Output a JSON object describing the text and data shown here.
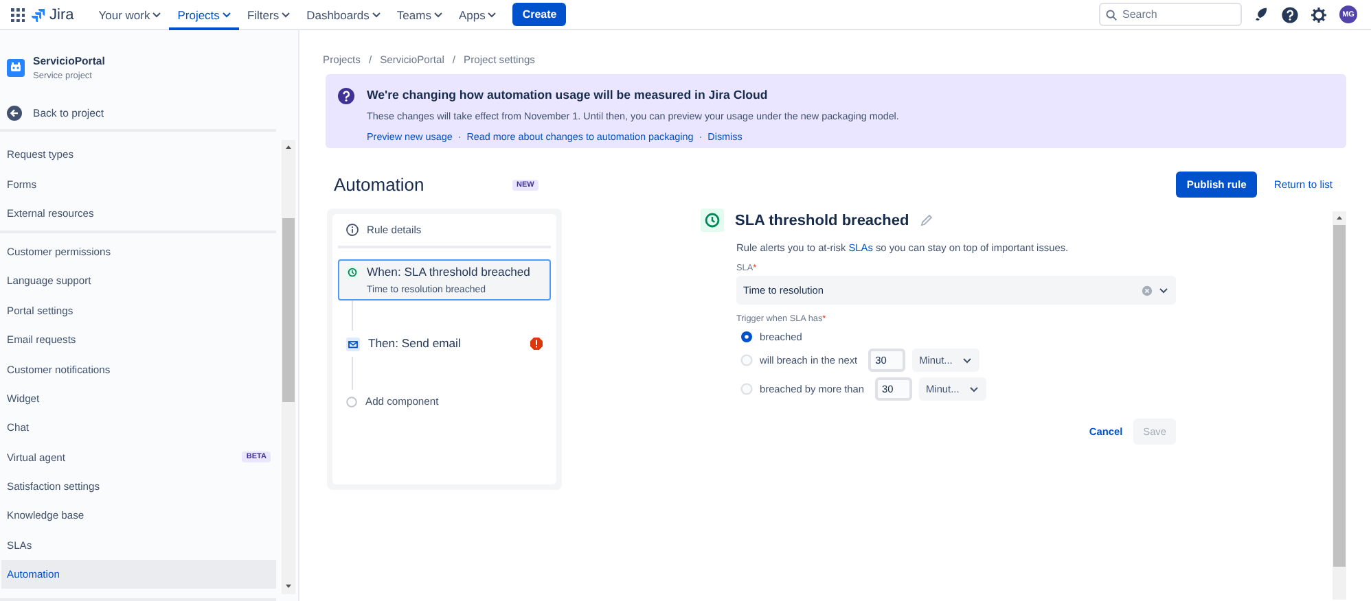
{
  "topnav": {
    "product": "Jira",
    "menus": [
      {
        "label": "Your work",
        "selected": false
      },
      {
        "label": "Projects",
        "selected": true
      },
      {
        "label": "Filters",
        "selected": false
      },
      {
        "label": "Dashboards",
        "selected": false
      },
      {
        "label": "Teams",
        "selected": false
      },
      {
        "label": "Apps",
        "selected": false
      }
    ],
    "create": "Create",
    "search": {
      "placeholder": "Search"
    },
    "avatar": "MG"
  },
  "sidebar": {
    "project": {
      "name": "ServicioPortal",
      "type": "Service project"
    },
    "back": "Back to project",
    "sections": [
      {
        "items": [
          {
            "label": "Request types",
            "selected": false
          },
          {
            "label": "Forms",
            "selected": false
          },
          {
            "label": "External resources",
            "selected": false
          }
        ]
      },
      {
        "items": [
          {
            "label": "Customer permissions",
            "selected": false
          },
          {
            "label": "Language support",
            "selected": false
          },
          {
            "label": "Portal settings",
            "selected": false
          },
          {
            "label": "Email requests",
            "selected": false
          },
          {
            "label": "Customer notifications",
            "selected": false
          },
          {
            "label": "Widget",
            "selected": false
          },
          {
            "label": "Chat",
            "selected": false
          },
          {
            "label": "Virtual agent",
            "selected": false,
            "badge": "BETA"
          },
          {
            "label": "Satisfaction settings",
            "selected": false
          },
          {
            "label": "Knowledge base",
            "selected": false
          },
          {
            "label": "SLAs",
            "selected": false
          },
          {
            "label": "Automation",
            "selected": true
          }
        ]
      }
    ]
  },
  "breadcrumbs": {
    "items": [
      "Projects",
      "ServicioPortal",
      "Project settings"
    ],
    "separator": "/"
  },
  "banner": {
    "title": "We're changing how automation usage will be measured in Jira Cloud",
    "text": "These changes will take effect from November 1. Until then, you can preview your usage under the new packaging model.",
    "links": [
      "Preview new usage",
      "Read more about changes to automation packaging",
      "Dismiss"
    ],
    "separator": "·"
  },
  "header": {
    "title": "Automation",
    "badge": "NEW",
    "primary": "Publish rule",
    "secondary": "Return to list"
  },
  "rule": {
    "details": "Rule details",
    "steps": [
      {
        "kind": "trigger",
        "title": "When: SLA threshold breached",
        "subtitle": "Time to resolution breached",
        "selected": true,
        "error": false
      },
      {
        "kind": "action",
        "title": "Then: Send email",
        "selected": false,
        "error": true
      },
      {
        "kind": "add",
        "title": "Add component",
        "selected": false,
        "error": false
      }
    ]
  },
  "config": {
    "title": "SLA threshold breached",
    "description_before": "Rule alerts you to at-risk",
    "description_link": "SLAs",
    "description_after": "so you can stay on top of important issues.",
    "sla_field": {
      "label": "SLA",
      "required_mark": "*",
      "value": "Time to resolution"
    },
    "trigger": {
      "label": "Trigger when SLA has",
      "required_mark": "*",
      "options": [
        {
          "label": "breached",
          "selected": true
        },
        {
          "label": "will breach in the next",
          "selected": false,
          "amount": "30",
          "unit": "Minut..."
        },
        {
          "label": "breached by more than",
          "selected": false,
          "amount": "30",
          "unit": "Minut..."
        }
      ]
    },
    "cancel": "Cancel",
    "save": "Save",
    "save_disabled": true
  }
}
